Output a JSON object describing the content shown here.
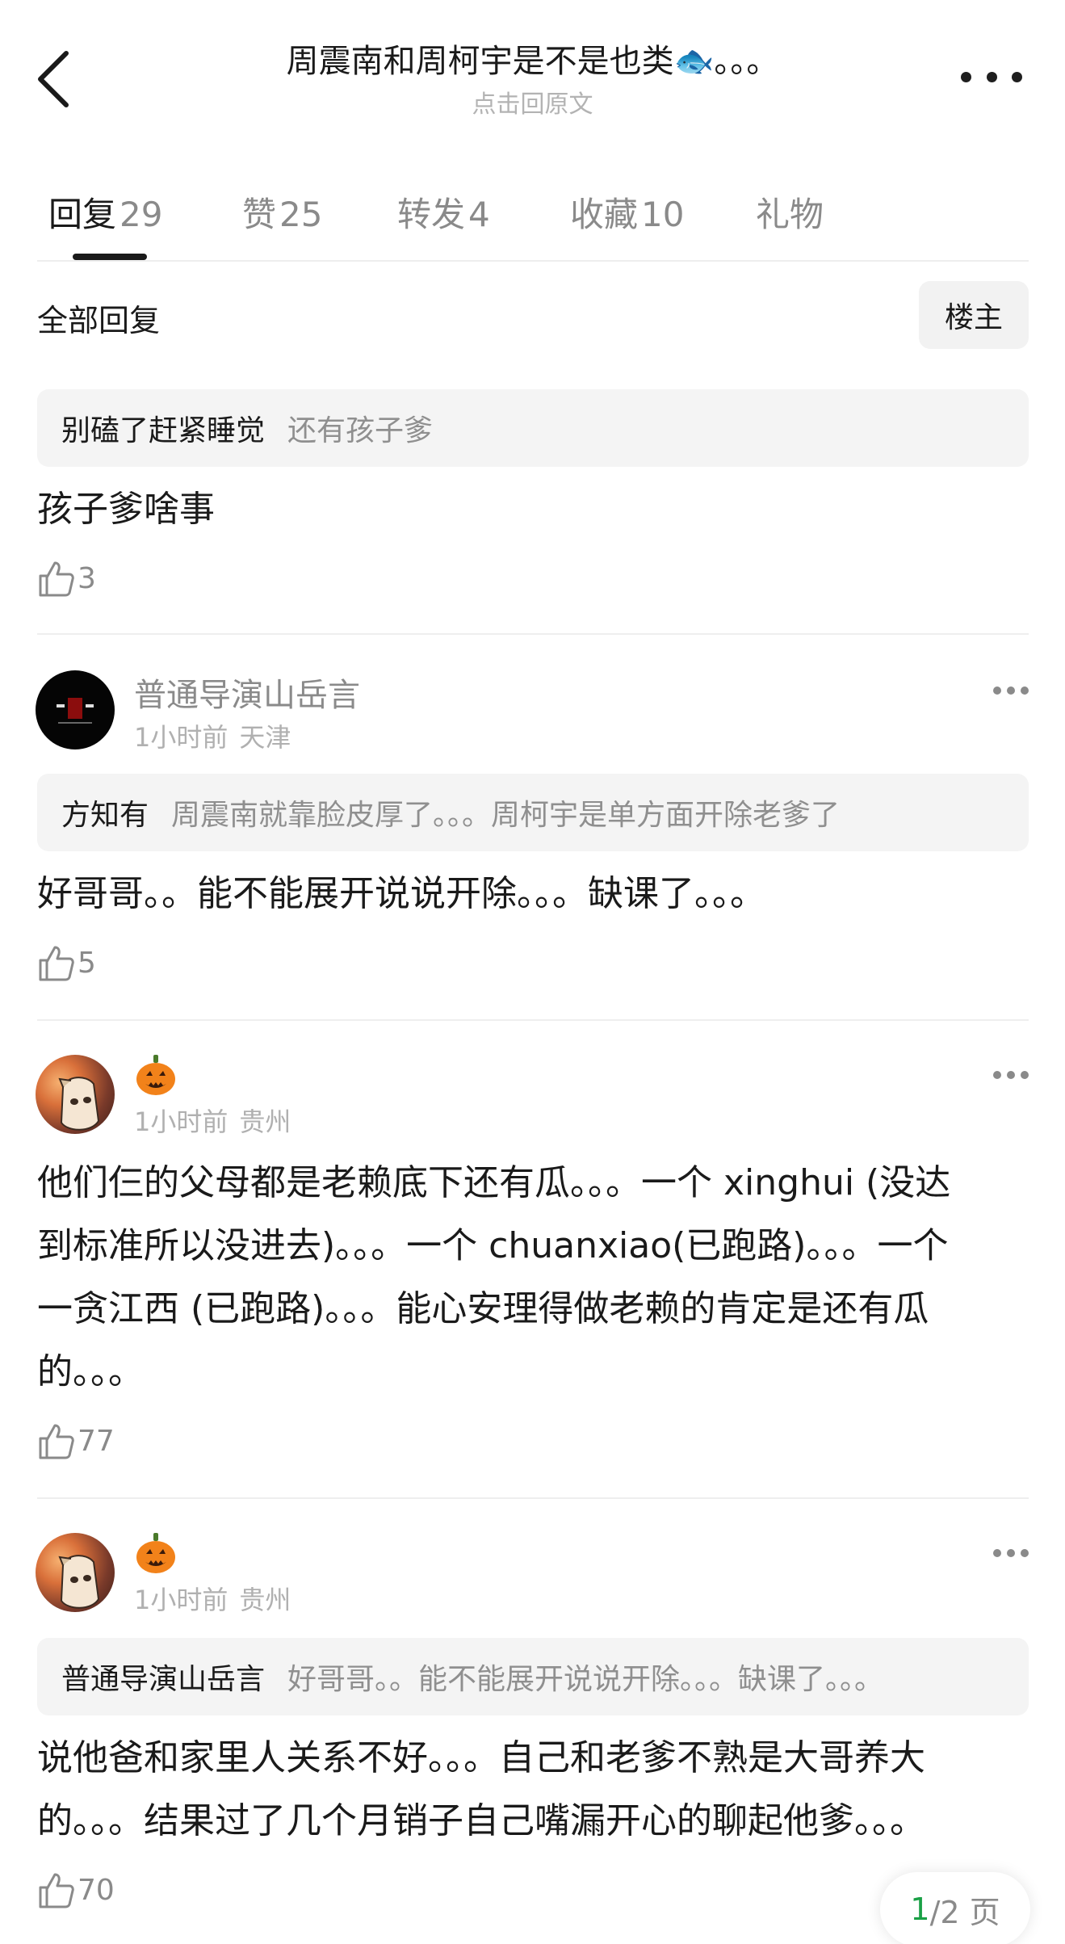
{
  "header": {
    "title": "周震南和周柯宇是不是也类🐟。。。",
    "subtitle": "点击回原文"
  },
  "tabs": [
    {
      "label": "回复",
      "count": "29"
    },
    {
      "label": "赞",
      "count": "25"
    },
    {
      "label": "转发",
      "count": "4"
    },
    {
      "label": "收藏",
      "count": "10"
    },
    {
      "label": "礼物",
      "count": ""
    }
  ],
  "filter": {
    "all_label": "全部回复",
    "owner_label": "楼主"
  },
  "replies": [
    {
      "quote_user": "别磕了赶紧睡觉",
      "quote_text": "还有孩子爹",
      "text": "孩子爹啥事",
      "likes": "3"
    },
    {
      "user": "普通导演山岳言",
      "time": "1小时前",
      "location": "天津",
      "quote_user": "方知有",
      "quote_text": "周震南就靠脸皮厚了。。。周柯宇是单方面开除老爹了",
      "text": "好哥哥。。能不能展开说说开除。。。缺课了。。。",
      "likes": "5"
    },
    {
      "user": "🎃",
      "time": "1小时前",
      "location": "贵州",
      "text_lines": [
        "他们仨的父母都是老赖底下还有瓜。。。一个 xinghui (没达",
        "到标准所以没进去)。。。一个 chuanxiao(已跑路)。。。一个",
        "一贪江西 (已跑路)。。。能心安理得做老赖的肯定是还有瓜",
        "的。。。"
      ],
      "likes": "77"
    },
    {
      "user": "🎃",
      "time": "1小时前",
      "location": "贵州",
      "quote_user": "普通导演山岳言",
      "quote_text": "好哥哥。。能不能展开说说开除。。。缺课了。。。",
      "text_lines": [
        "说他爸和家里人关系不好。。。自己和老爹不熟是大哥养大",
        "的。。。结果过了几个月销子自己嘴漏开心的聊起他爹。。。"
      ],
      "likes": "70"
    }
  ],
  "pager": {
    "current": "1",
    "rest": "/2 页"
  },
  "icons": {
    "back": "chevron-left-icon",
    "more": "more-dots-icon",
    "like": "thumbs-up-icon"
  }
}
